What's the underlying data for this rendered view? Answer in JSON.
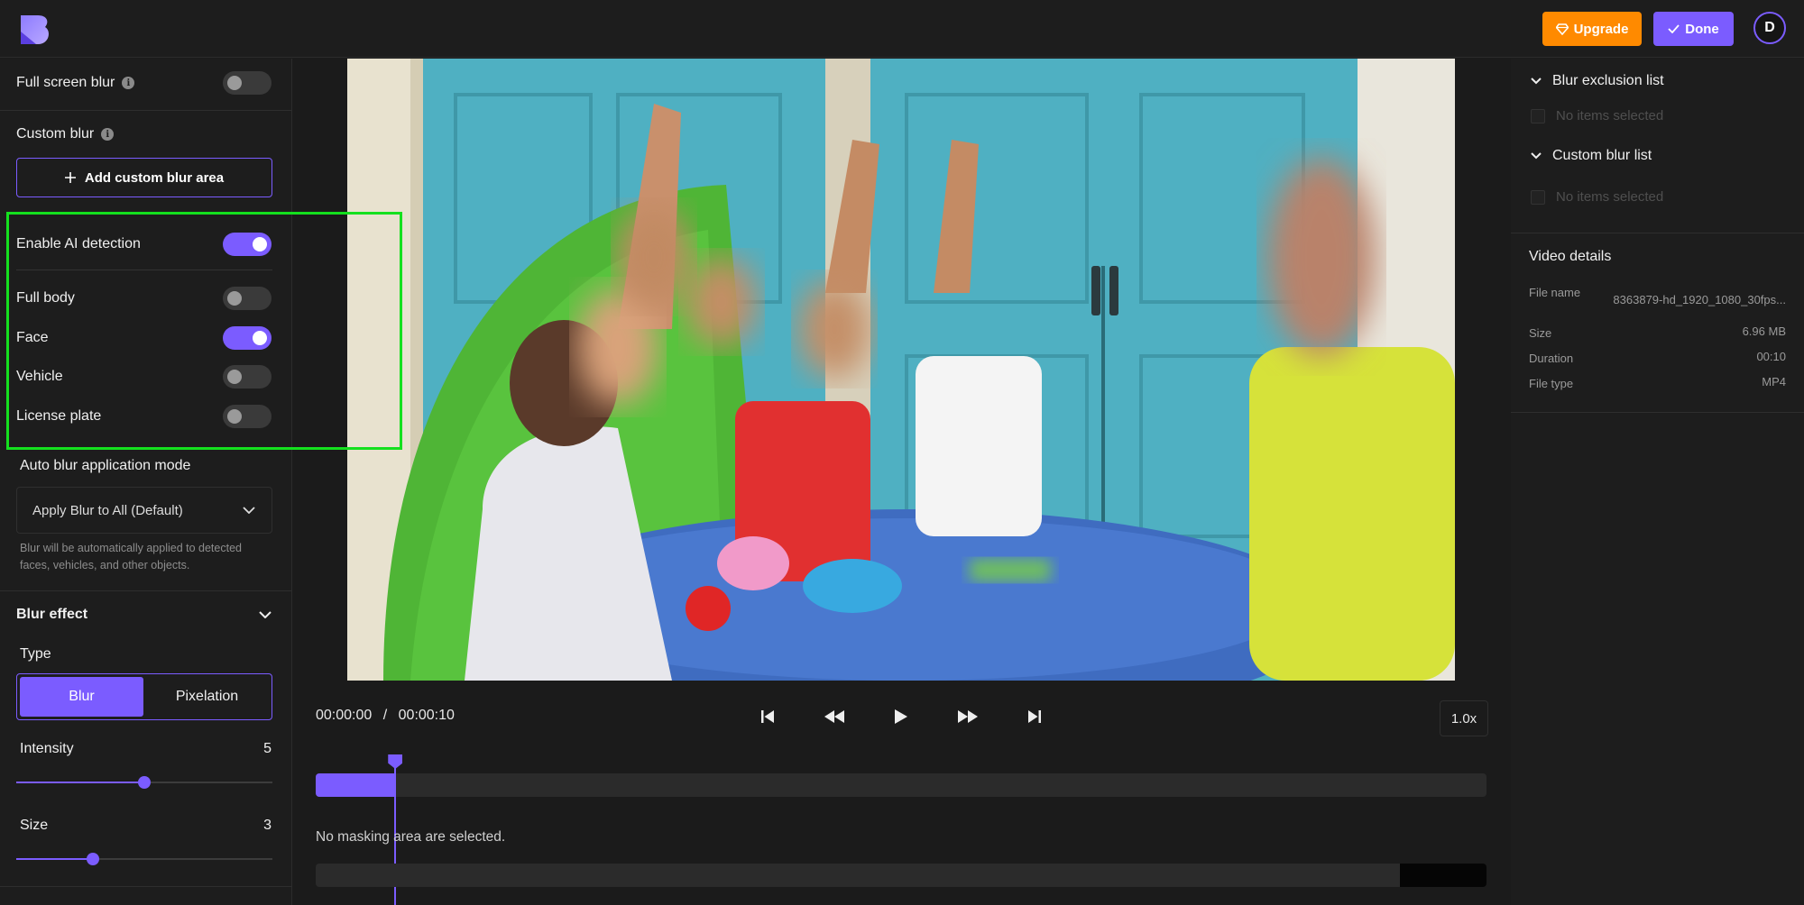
{
  "header": {
    "upgrade_label": "Upgrade",
    "done_label": "Done",
    "avatar_initial": "D"
  },
  "left_panel": {
    "full_screen_blur": {
      "label": "Full screen blur",
      "on": false
    },
    "custom_blur": {
      "label": "Custom blur",
      "add_label": "Add custom blur area"
    },
    "ai": {
      "enable_label": "Enable AI detection",
      "enabled": true,
      "options": [
        {
          "label": "Full body",
          "on": false
        },
        {
          "label": "Face",
          "on": true
        },
        {
          "label": "Vehicle",
          "on": false
        },
        {
          "label": "License plate",
          "on": false
        }
      ]
    },
    "auto_mode": {
      "label": "Auto blur application mode",
      "selected": "Apply Blur to All (Default)",
      "helper": "Blur will be automatically applied to detected faces, vehicles, and other objects."
    },
    "blur_effect": {
      "title": "Blur effect",
      "type_label": "Type",
      "types": [
        "Blur",
        "Pixelation"
      ],
      "active_type": "Blur",
      "intensity": {
        "label": "Intensity",
        "value": "5",
        "fraction": 0.5
      },
      "size": {
        "label": "Size",
        "value": "3",
        "fraction": 0.3
      }
    }
  },
  "player": {
    "current_time": "00:00:00",
    "separator": "/",
    "duration": "00:00:10",
    "speed": "1.0x",
    "progress_fraction": 0.068,
    "no_mask_text": "No masking area are selected."
  },
  "right_panel": {
    "blur_exclusion": {
      "title": "Blur exclusion list",
      "empty": "No items selected"
    },
    "custom_blur_list": {
      "title": "Custom blur list",
      "empty": "No items selected"
    },
    "video_details": {
      "title": "Video details",
      "rows": [
        {
          "key": "File name",
          "value": "8363879-hd_1920_1080_30fps..."
        },
        {
          "key": "Size",
          "value": "6.96 MB"
        },
        {
          "key": "Duration",
          "value": "00:10"
        },
        {
          "key": "File type",
          "value": "MP4"
        }
      ]
    }
  },
  "colors": {
    "accent": "#7b5cff",
    "upgrade": "#ff8a00",
    "highlight_box": "#14e01e",
    "background": "#1b1b1b"
  }
}
